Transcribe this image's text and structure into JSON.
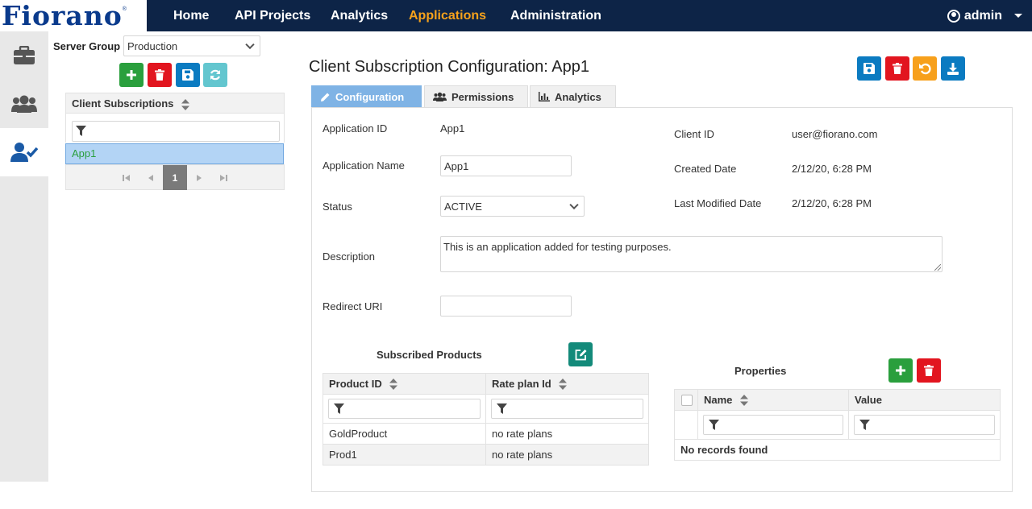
{
  "brand": {
    "logo_text": "Fiorano",
    "reg": "®"
  },
  "nav": {
    "items": [
      {
        "label": "Home",
        "active": false
      },
      {
        "label": "API Projects",
        "active": false
      },
      {
        "label": "Analytics",
        "active": false
      },
      {
        "label": "Applications",
        "active": true
      },
      {
        "label": "Administration",
        "active": false
      }
    ],
    "user": "admin"
  },
  "rail": {
    "items": [
      {
        "icon": "briefcase-icon"
      },
      {
        "icon": "users-icon"
      },
      {
        "icon": "user-check-icon",
        "active": true
      }
    ]
  },
  "left": {
    "server_group_label": "Server Group",
    "server_group_value": "Production",
    "toolbar": [
      {
        "icon": "plus-icon",
        "color": "#2a9f3d"
      },
      {
        "icon": "trash-icon",
        "color": "#e2151f"
      },
      {
        "icon": "save-icon",
        "color": "#0b7bc1"
      },
      {
        "icon": "refresh-icon",
        "color": "#63c6cf"
      }
    ],
    "list_header": "Client Subscriptions",
    "rows": [
      "App1"
    ],
    "page": "1"
  },
  "main": {
    "title": "Client Subscription Configuration: App1",
    "tabs": [
      {
        "label": "Configuration",
        "active": true
      },
      {
        "label": "Permissions"
      },
      {
        "label": "Analytics"
      }
    ],
    "form": {
      "application_id_label": "Application ID",
      "application_id": "App1",
      "application_name_label": "Application Name",
      "application_name": "App1",
      "status_label": "Status",
      "status": "ACTIVE",
      "description_label": "Description",
      "description": "This is an application added for testing purposes.",
      "redirect_uri_label": "Redirect URI",
      "redirect_uri": "",
      "client_id_label": "Client ID",
      "client_id": "user@fiorano.com",
      "created_label": "Created Date",
      "created": "2/12/20, 6:28 PM",
      "modified_label": "Last Modified Date",
      "modified": "2/12/20, 6:28 PM"
    },
    "subscribed": {
      "title": "Subscribed Products",
      "columns": [
        "Product ID",
        "Rate plan Id"
      ],
      "rows": [
        [
          "GoldProduct",
          "no rate plans"
        ],
        [
          "Prod1",
          "no rate plans"
        ]
      ]
    },
    "properties": {
      "title": "Properties",
      "columns": [
        "Name",
        "Value"
      ],
      "empty": "No records found"
    }
  }
}
